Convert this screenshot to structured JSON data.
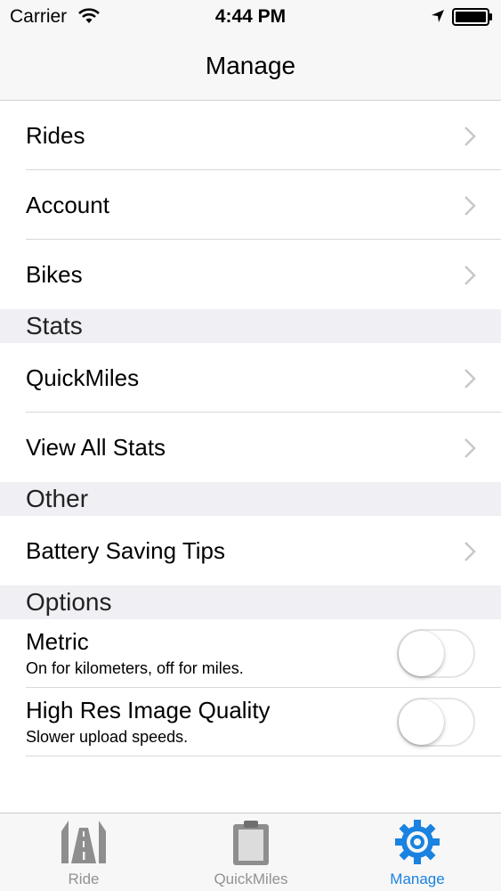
{
  "status_bar": {
    "carrier": "Carrier",
    "time": "4:44 PM",
    "icons": [
      "wifi-icon",
      "location-arrow-icon",
      "battery-icon"
    ]
  },
  "nav": {
    "title": "Manage"
  },
  "groups": [
    {
      "header": "",
      "rows": [
        {
          "label": "Rides"
        },
        {
          "label": "Account"
        },
        {
          "label": "Bikes"
        }
      ]
    },
    {
      "header": "Stats",
      "rows": [
        {
          "label": "QuickMiles"
        },
        {
          "label": "View All Stats"
        }
      ]
    },
    {
      "header": "Other",
      "rows": [
        {
          "label": "Battery Saving Tips"
        }
      ]
    }
  ],
  "options": {
    "header": "Options",
    "toggles": [
      {
        "title": "Metric",
        "subtitle": "On for kilometers, off for miles.",
        "on": false
      },
      {
        "title": "High Res Image Quality",
        "subtitle": "Slower upload speeds.",
        "on": false
      }
    ]
  },
  "tab_bar": {
    "tabs": [
      {
        "label": "Ride",
        "icon": "road-icon",
        "active": false
      },
      {
        "label": "QuickMiles",
        "icon": "clipboard-icon",
        "active": false
      },
      {
        "label": "Manage",
        "icon": "gear-icon",
        "active": true
      }
    ],
    "active_color": "#1a82e0",
    "inactive_color": "#929292"
  }
}
